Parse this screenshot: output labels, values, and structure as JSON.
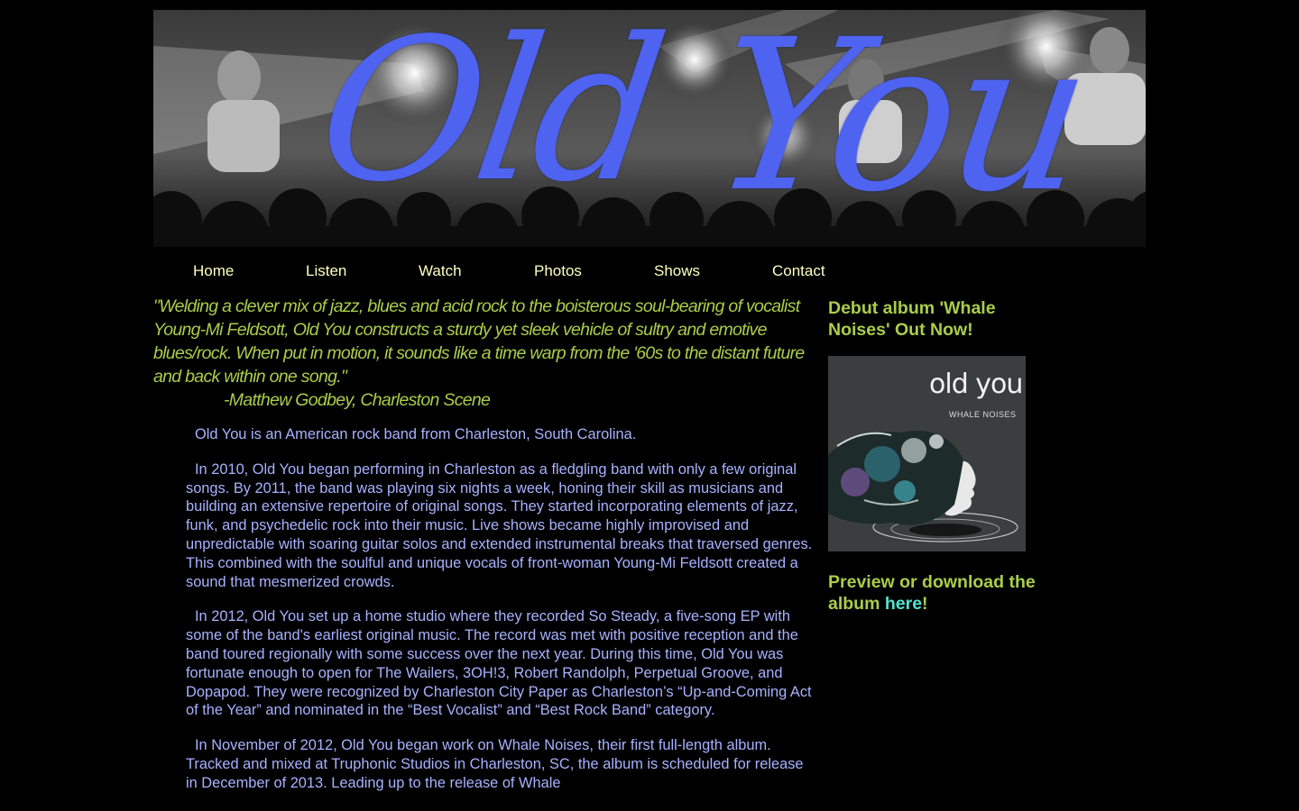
{
  "banner": {
    "title_word_1": "Old",
    "title_word_2": "You"
  },
  "nav": {
    "items": [
      {
        "label": "Home"
      },
      {
        "label": "Listen"
      },
      {
        "label": "Watch"
      },
      {
        "label": "Photos"
      },
      {
        "label": "Shows"
      },
      {
        "label": "Contact"
      }
    ]
  },
  "quote": {
    "text": "\"Welding a clever mix of jazz, blues and acid rock to the boisterous soul-bearing of vocalist Young-Mi Feldsott, Old You constructs a sturdy yet sleek vehicle of sultry and emotive blues/rock. When put in motion, it sounds like a time warp from the '60s to the distant future and back within one song.\"",
    "attribution": "-Matthew Godbey, Charleston Scene"
  },
  "body": {
    "paragraphs": [
      "Old You is an American rock band from Charleston, South Carolina.",
      "In 2010, Old You began performing in Charleston as a fledgling band with only a few original songs. By 2011, the band was playing six nights a week, honing their skill as musicians and building an extensive repertoire of original songs. They started incorporating elements of jazz, funk, and psychedelic rock into their music. Live shows became highly improvised and unpredictable with soaring guitar solos and extended instrumental breaks that traversed genres. This combined with the soulful and unique vocals of front-woman Young-Mi Feldsott created a sound that mesmerized crowds.",
      "In 2012, Old You set up a home studio where they recorded So Steady, a five-song EP with some of the band's earliest original music. The record was met with positive reception and the band toured regionally with some success over the next year. During this time, Old You was fortunate enough to open for The Wailers, 3OH!3, Robert Randolph, Perpetual Groove, and Dopapod. They were recognized by Charleston City Paper as Charleston’s “Up-and-Coming Act of the Year” and nominated in the “Best Vocalist” and “Best Rock Band” category.",
      "In November of 2012, Old You began work on Whale Noises, their first full-length album. Tracked and mixed at Truphonic Studios in Charleston, SC, the album is scheduled for release in December of 2013. Leading up to the release of Whale"
    ]
  },
  "sidebar": {
    "heading": "Debut album 'Whale Noises' Out Now!",
    "album_art": {
      "brand": "old you",
      "subtitle": "WHALE NOISES"
    },
    "preview_text": "Preview or download the album ",
    "preview_link": "here",
    "preview_suffix": "!"
  },
  "colors": {
    "background": "#000000",
    "nav_text": "#ffffc2",
    "accent_green": "#aacd4b",
    "body_text": "#a7b2ff",
    "link": "#54e3cf",
    "title_blue": "#4e63f0"
  }
}
